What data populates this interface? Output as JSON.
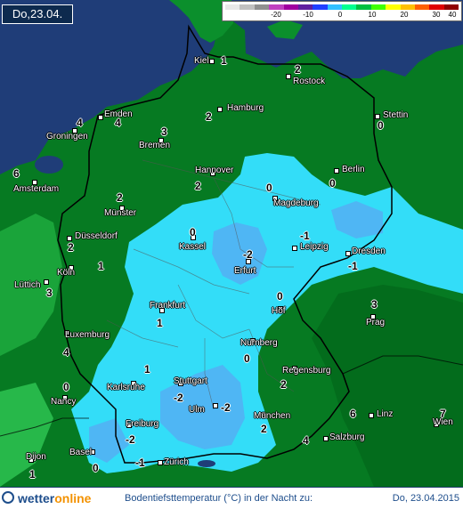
{
  "date_label": "Do,23.04.",
  "legend": {
    "colors": [
      "#e8e8e8",
      "#c0c0c0",
      "#909090",
      "#c040c0",
      "#a000a0",
      "#6020a0",
      "#2040ff",
      "#30c0ff",
      "#00ff90",
      "#00c040",
      "#40ff00",
      "#ffff00",
      "#ffc000",
      "#ff6000",
      "#e00000",
      "#900000"
    ],
    "ticks": [
      "-20",
      "-10",
      "0",
      "10",
      "20",
      "30",
      "40"
    ]
  },
  "cities": [
    {
      "name": "Kiel",
      "value": "1"
    },
    {
      "name": "Rostock",
      "value": "2"
    },
    {
      "name": "Hamburg",
      "value": "2"
    },
    {
      "name": "Stettin",
      "value": "0"
    },
    {
      "name": "Emden",
      "value": "4"
    },
    {
      "name": "Groningen",
      "value": "4"
    },
    {
      "name": "Bremen",
      "value": "3"
    },
    {
      "name": "Amsterdam",
      "value": "6"
    },
    {
      "name": "Hannover",
      "value": "2"
    },
    {
      "name": "Berlin",
      "value": "0"
    },
    {
      "name": "Magdeburg",
      "value": "0"
    },
    {
      "name": "Münster",
      "value": "2"
    },
    {
      "name": "Düsseldorf",
      "value": "2"
    },
    {
      "name": "Kassel",
      "value": "0"
    },
    {
      "name": "Leipzig",
      "value": "-1"
    },
    {
      "name": "Dresden",
      "value": "-1"
    },
    {
      "name": "Köln",
      "value": "1"
    },
    {
      "name": "Erfurt",
      "value": "-2"
    },
    {
      "name": "Lüttich",
      "value": "3"
    },
    {
      "name": "Frankfurt",
      "value": "1"
    },
    {
      "name": "Hof",
      "value": "0"
    },
    {
      "name": "Prag",
      "value": "3"
    },
    {
      "name": "Luxemburg",
      "value": "4"
    },
    {
      "name": "Nürnberg",
      "value": "0"
    },
    {
      "name": "Regensburg",
      "value": "2"
    },
    {
      "name": "Karlsruhe",
      "value": "1"
    },
    {
      "name": "Nancy",
      "value": "0"
    },
    {
      "name": "Stuttgart",
      "value": "-2"
    },
    {
      "name": "Ulm",
      "value": "-2"
    },
    {
      "name": "München",
      "value": "2"
    },
    {
      "name": "Linz",
      "value": "6"
    },
    {
      "name": "Wien",
      "value": "7"
    },
    {
      "name": "Freiburg",
      "value": "-2"
    },
    {
      "name": "Salzburg",
      "value": "4"
    },
    {
      "name": "Basel",
      "value": "0"
    },
    {
      "name": "Zürich",
      "value": "-1"
    },
    {
      "name": "Dijon",
      "value": "1"
    }
  ],
  "footer": {
    "logo_pre": "wetter",
    "logo_post": "online",
    "caption": "Bodentiefsttemperatur (°C) in der Nacht zu:",
    "date": "Do, 23.04.2015"
  }
}
